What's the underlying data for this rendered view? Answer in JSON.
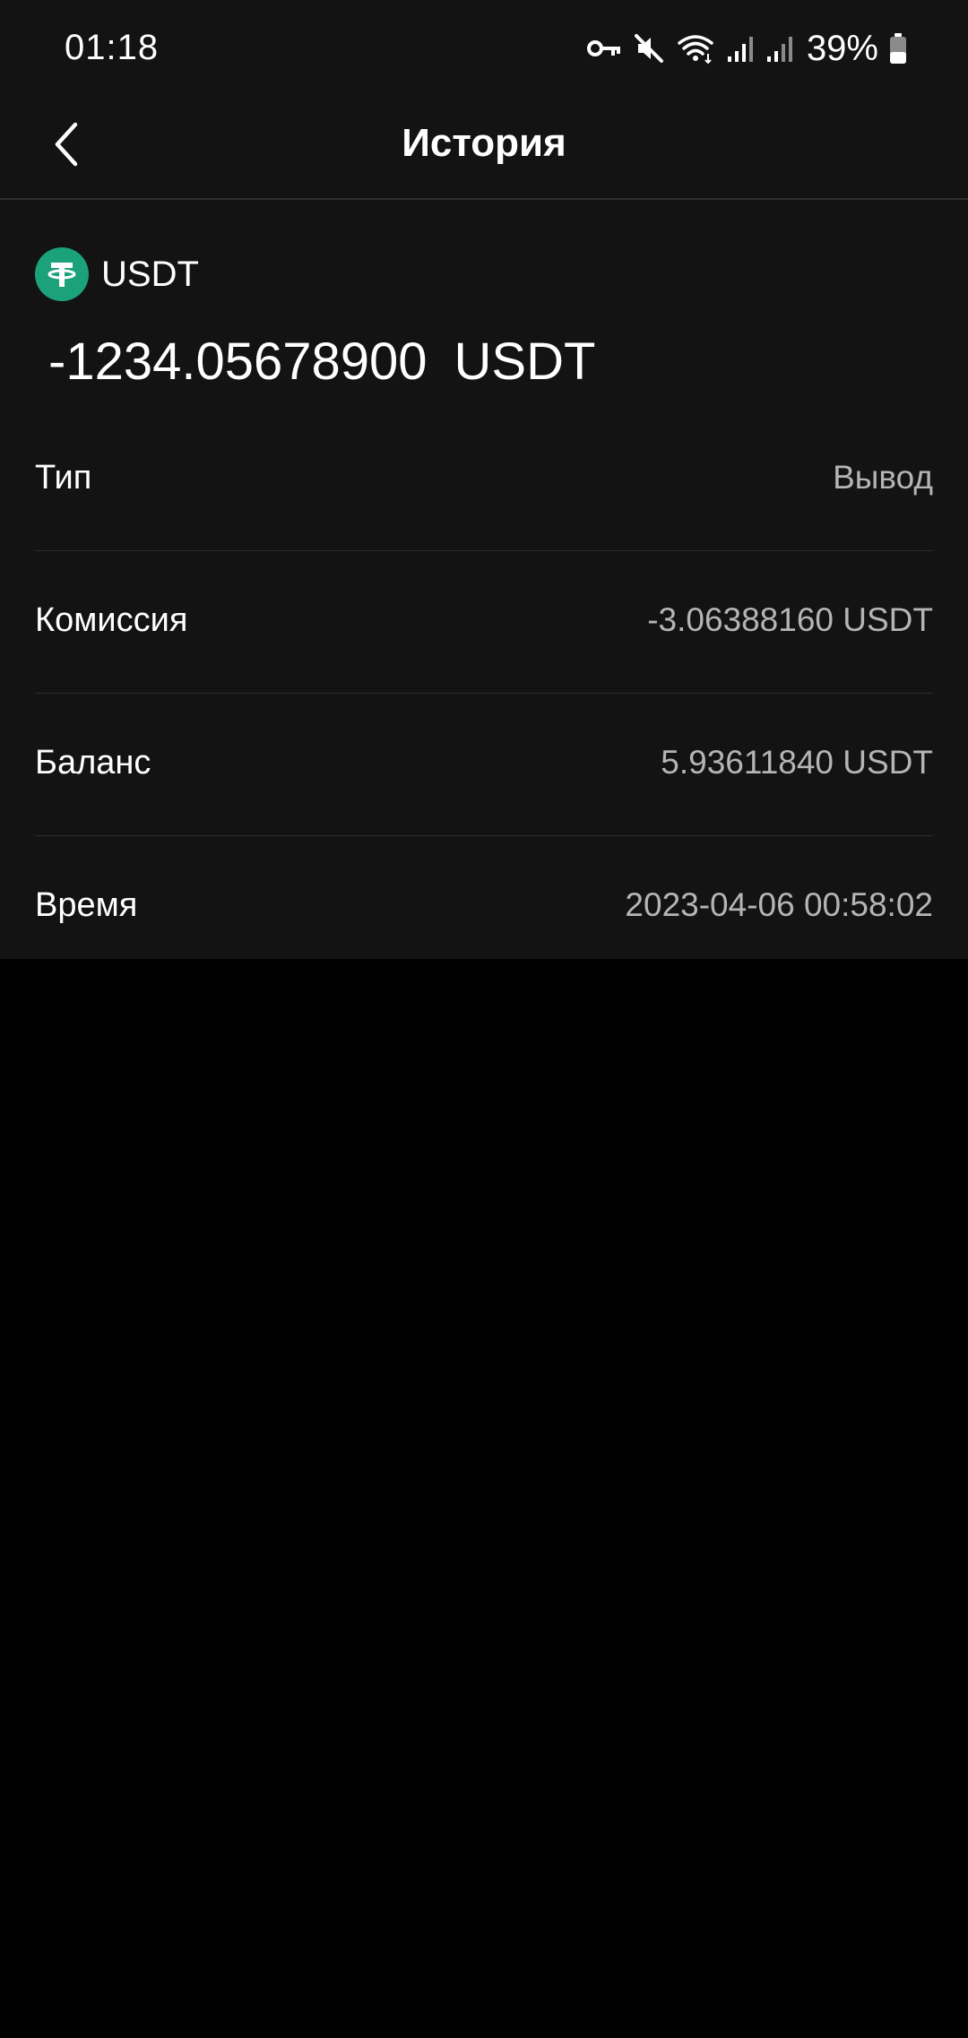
{
  "status_bar": {
    "time": "01:18",
    "battery": "39%",
    "icons": [
      "vpn-key-icon",
      "mute-icon",
      "wifi-icon",
      "signal-icon",
      "signal-icon",
      "battery-icon"
    ]
  },
  "header": {
    "title": "История",
    "back_icon": "chevron-left-icon"
  },
  "asset": {
    "icon": "tether-icon",
    "name": "USDT",
    "amount": "-1234.05678900",
    "amount_unit": "USDT"
  },
  "details": [
    {
      "label": "Тип",
      "value": "Вывод"
    },
    {
      "label": "Комиссия",
      "value": "-3.06388160 USDT"
    },
    {
      "label": "Баланс",
      "value": "5.93611840 USDT"
    },
    {
      "label": "Время",
      "value": "2023-04-06 00:58:02"
    }
  ],
  "colors": {
    "panel_bg": "#131313",
    "page_bg": "#000000",
    "coin_green": "#1ba27a",
    "value_text": "#b5b5b5"
  }
}
